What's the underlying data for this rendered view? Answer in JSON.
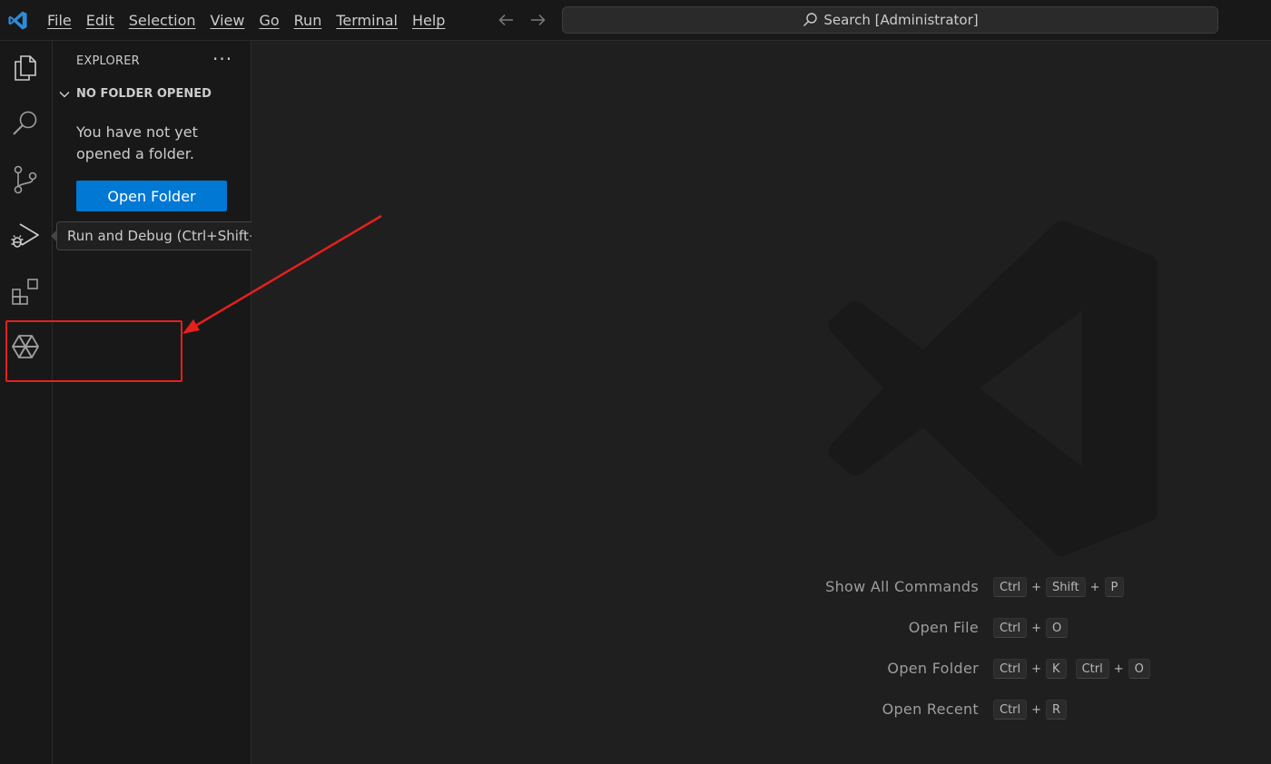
{
  "menu": [
    "File",
    "Edit",
    "Selection",
    "View",
    "Go",
    "Run",
    "Terminal",
    "Help"
  ],
  "search": {
    "text": "Search [Administrator]"
  },
  "activity_bar": {
    "icons": [
      "explorer-icon",
      "search-icon",
      "source-control-icon",
      "run-debug-icon",
      "extensions-icon",
      "extension-logo-icon"
    ]
  },
  "sidebar": {
    "title": "EXPLORER",
    "more": "···",
    "section": "NO FOLDER OPENED",
    "message": "You have not yet opened a folder.",
    "open_folder_label": "Open Folder"
  },
  "tooltip": {
    "text": "Run and Debug (Ctrl+Shift+D)"
  },
  "shortcuts": [
    {
      "label": "Show All Commands",
      "keys": [
        [
          "Ctrl",
          "Shift",
          "P"
        ]
      ]
    },
    {
      "label": "Open File",
      "keys": [
        [
          "Ctrl",
          "O"
        ]
      ]
    },
    {
      "label": "Open Folder",
      "keys": [
        [
          "Ctrl",
          "K"
        ],
        [
          "Ctrl",
          "O"
        ]
      ]
    },
    {
      "label": "Open Recent",
      "keys": [
        [
          "Ctrl",
          "R"
        ]
      ]
    }
  ],
  "colors": {
    "accent": "#0078d4",
    "annotation": "#e5201d",
    "background": "#1f1f1f",
    "panel": "#181818"
  }
}
